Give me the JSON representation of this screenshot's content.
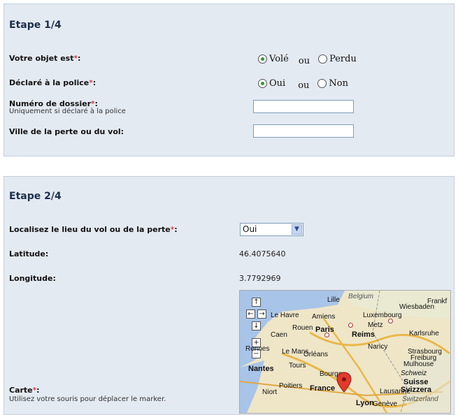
{
  "step1": {
    "title": "Etape 1/4",
    "object_label": "Votre objet est",
    "object_options": [
      "Volé",
      "Perdu"
    ],
    "object_selected": "Volé",
    "ou": "ou",
    "police_label": "Déclaré à la police",
    "police_options": [
      "Oui",
      "Non"
    ],
    "police_selected": "Oui",
    "dossier_label": "Numéro de dossier",
    "dossier_hint": "Uniquement si déclaré à la police",
    "dossier_value": "",
    "ville_label": "Ville de la perte ou du vol:",
    "ville_value": ""
  },
  "step2": {
    "title": "Etape 2/4",
    "localise_label": "Localisez le lieu du vol ou de la perte",
    "localise_value": "Oui",
    "latitude_label": "Latitude:",
    "latitude_value": "46.4075640",
    "longitude_label": "Longitude:",
    "longitude_value": "3.7792969",
    "carte_label": "Carte",
    "carte_hint": "Utilisez votre souris pour déplacer le marker.",
    "map_cities": [
      "Lille",
      "Belgium",
      "Frankf",
      "Wiesbaden",
      "Le Havre",
      "Amiens",
      "Luxembourg",
      "Rouen",
      "Paris",
      "Metz",
      "Caen",
      "Reims",
      "Karlsruhe",
      "Rennes",
      "Le Mans",
      "Nancy",
      "Strasbourg",
      "Orléans",
      "Freiburg",
      "Mulhouse",
      "Nantes",
      "Tours",
      "Schweiz",
      "Niort",
      "Poitiers",
      "France",
      "Bourges",
      "Suisse",
      "Svizzera",
      "Lausanne",
      "Switzerland",
      "Lyon",
      "Genève"
    ],
    "required_mark": "*"
  }
}
